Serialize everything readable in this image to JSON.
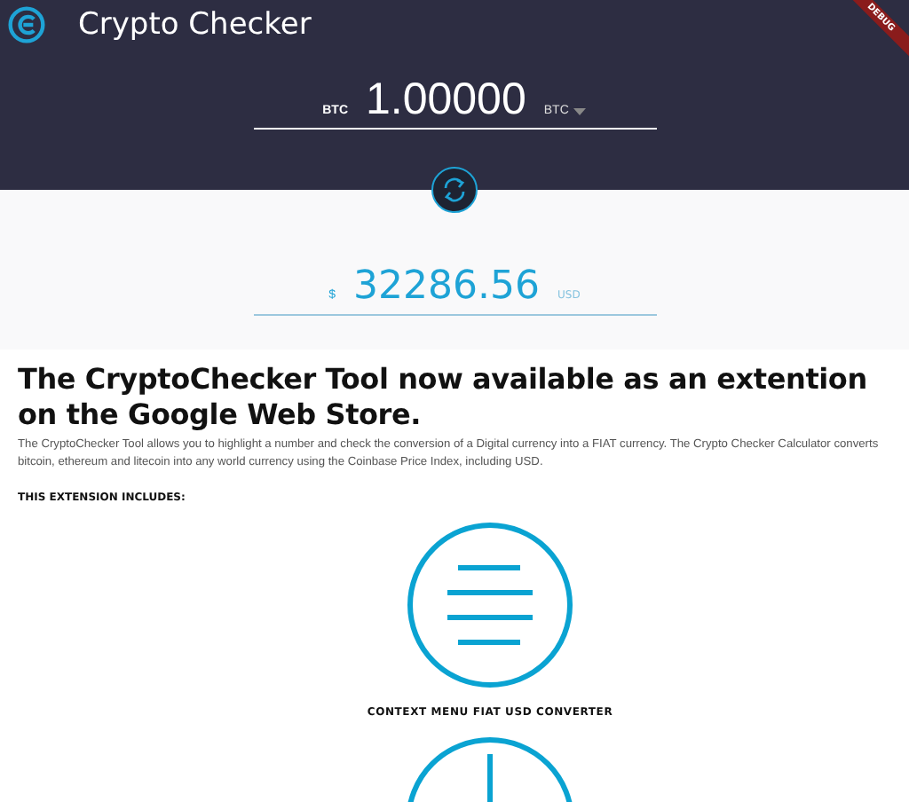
{
  "app_bar": {
    "title": "Crypto Checker"
  },
  "debug_banner": "DEBUG",
  "converter": {
    "from_label": "BTC",
    "amount": "1.00000",
    "to_currency": "BTC"
  },
  "result": {
    "symbol": "$",
    "amount": "32286.56",
    "currency": "USD"
  },
  "article": {
    "heading": "The CryptoChecker Tool now available as an extention on the Google Web Store.",
    "paragraph": "The CryptoChecker Tool allows you to highlight a number and check the conversion of a Digital currency into a FIAT currency. The Crypto Checker Calculator converts bitcoin, ethereum and litecoin into any world currency using the Coinbase Price Index, including USD.",
    "includes_heading": "THIS EXTENSION INCLUDES:",
    "features": [
      {
        "kind": "menu",
        "label": "CONTEXT MENU FIAT USD CONVERTER"
      },
      {
        "kind": "dial"
      }
    ]
  }
}
